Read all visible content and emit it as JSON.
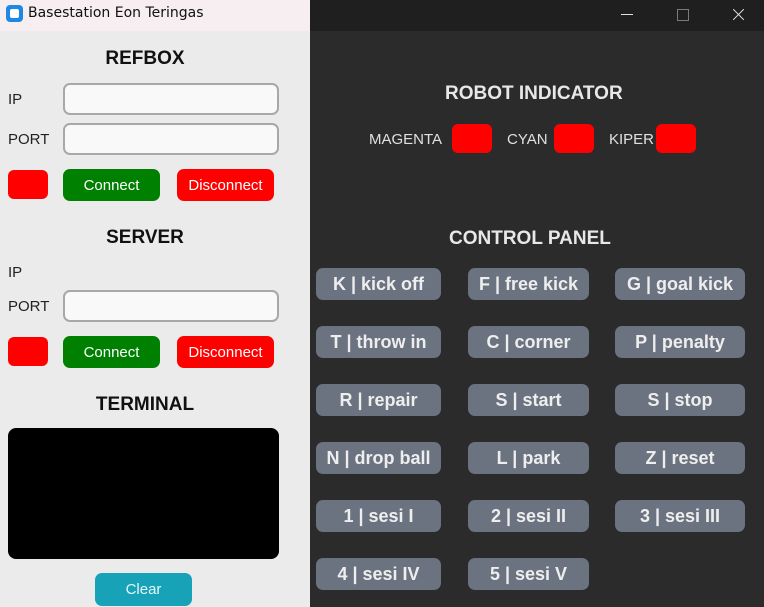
{
  "window": {
    "title": "Basestation Eon Teringas"
  },
  "refbox": {
    "title": "REFBOX",
    "ip_label": "IP",
    "ip_value": "",
    "port_label": "PORT",
    "port_value": "",
    "status_color": "#ff0000",
    "connect_label": "Connect",
    "disconnect_label": "Disconnect"
  },
  "server": {
    "title": "SERVER",
    "ip_label": "IP",
    "port_label": "PORT",
    "port_value": "",
    "status_color": "#ff0000",
    "connect_label": "Connect",
    "disconnect_label": "Disconnect"
  },
  "terminal": {
    "title": "TERMINAL",
    "content": "",
    "clear_label": "Clear"
  },
  "robot_indicator": {
    "title": "ROBOT INDICATOR",
    "items": [
      {
        "label": "MAGENTA",
        "color": "#ff0000"
      },
      {
        "label": "CYAN",
        "color": "#ff0000"
      },
      {
        "label": "KIPER",
        "color": "#ff0000"
      }
    ]
  },
  "control_panel": {
    "title": "CONTROL PANEL",
    "buttons": [
      "K | kick off",
      "F | free kick",
      "G | goal kick",
      "T | throw in",
      "C | corner",
      "P | penalty",
      "R | repair",
      "S | start",
      "S | stop",
      "N | drop ball",
      "L | park",
      "Z | reset",
      "1 | sesi I",
      "2 | sesi II",
      "3 | sesi III",
      "4 | sesi IV",
      "5 | sesi V"
    ]
  },
  "colors": {
    "connect": "#008000",
    "disconnect": "#ff0000",
    "control_button": "#6b7280",
    "clear_button": "#17a2b8",
    "dark_background": "#2b2b2b"
  }
}
